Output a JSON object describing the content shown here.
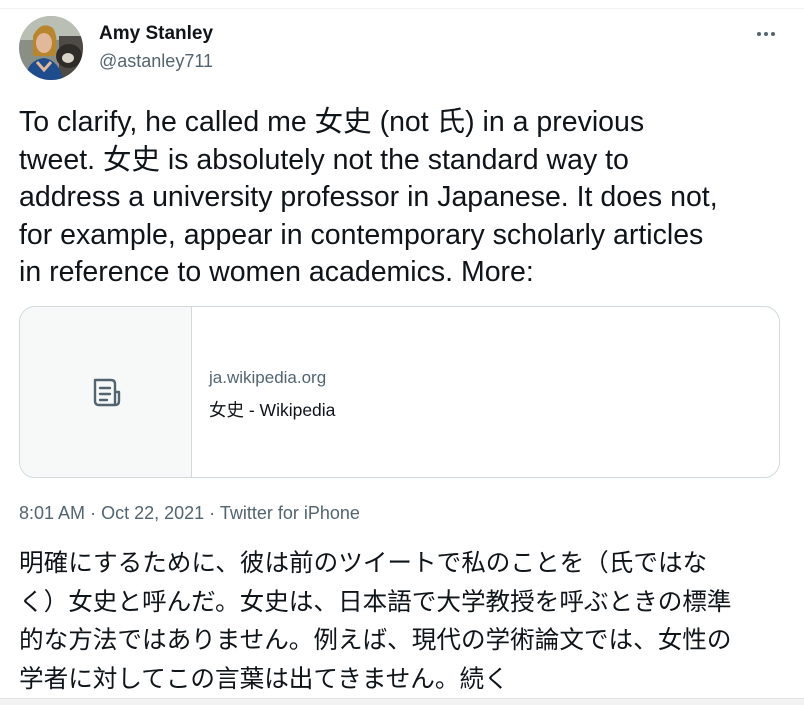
{
  "tweet": {
    "author": {
      "name": "Amy Stanley",
      "handle": "@astanley711",
      "avatar_icon": "profile-photo"
    },
    "more_icon": "more-horizontal-icon",
    "text_lines": [
      "To clarify, he called me 女史 (not 氏) in a previous",
      "tweet. 女史 is absolutely not the standard way to",
      "address a university professor in Japanese. It does not,",
      "for example, appear in contemporary scholarly articles",
      "in reference to women academics. More:"
    ],
    "link_card": {
      "thumb_icon": "document-icon",
      "domain": "ja.wikipedia.org",
      "title": "女史 - Wikipedia"
    },
    "meta": {
      "time": "8:01 AM",
      "date": "Oct 22, 2021",
      "source": "Twitter for iPhone",
      "separator": "·"
    },
    "translation_lines": [
      "明確にするために、彼は前のツイートで私のことを（氏ではな",
      "く）女史と呼んだ。女史は、日本語で大学教授を呼ぶときの標準",
      "的な方法ではありません。例えば、現代の学術論文では、女性の",
      "学者に対してこの言葉は出てきません。続く"
    ]
  },
  "colors": {
    "text_primary": "#0f1419",
    "text_secondary": "#536471",
    "border": "#cfd9de",
    "card_thumb_bg": "#f7f9f9"
  }
}
